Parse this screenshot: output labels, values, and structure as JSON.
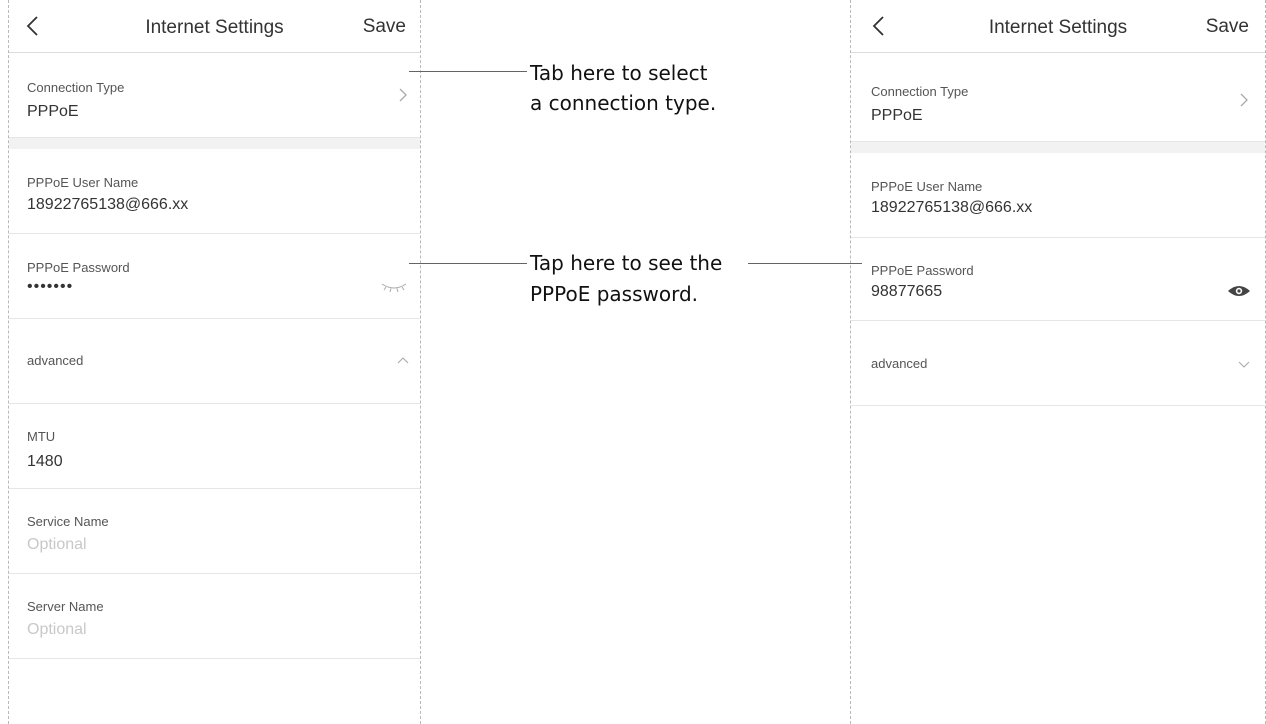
{
  "left_screen": {
    "header": {
      "back_icon": "chevron-left-icon",
      "title": "Internet Settings",
      "save_label": "Save"
    },
    "connection_type": {
      "label": "Connection Type",
      "value": "PPPoE",
      "icon": "chevron-right-icon"
    },
    "user_name": {
      "label": "PPPoE User Name",
      "value": "18922765138@666.xx"
    },
    "password": {
      "label": "PPPoE Password",
      "value": "•••••••",
      "icon": "eye-closed-icon"
    },
    "advanced": {
      "label": "advanced",
      "icon": "chevron-up-icon"
    },
    "mtu": {
      "label": "MTU",
      "value": "1480"
    },
    "service_name": {
      "label": "Service Name",
      "placeholder": "Optional"
    },
    "server_name": {
      "label": "Server Name",
      "placeholder": "Optional"
    }
  },
  "right_screen": {
    "header": {
      "back_icon": "chevron-left-icon",
      "title": "Internet Settings",
      "save_label": "Save"
    },
    "connection_type": {
      "label": "Connection Type",
      "value": "PPPoE",
      "icon": "chevron-right-icon"
    },
    "user_name": {
      "label": "PPPoE User Name",
      "value": "18922765138@666.xx"
    },
    "password": {
      "label": "PPPoE Password",
      "value": "98877665",
      "icon": "eye-open-icon"
    },
    "advanced": {
      "label": "advanced",
      "icon": "chevron-down-icon"
    }
  },
  "callouts": {
    "connection_line1": "Tab here to select",
    "connection_line2": "a connection type.",
    "password_line1": "Tap here to see the",
    "password_line2": "PPPoE password."
  },
  "colors": {
    "callout_line": "#2f6ebd",
    "divider": "#e6e6e6",
    "section_gap": "#f2f2f2",
    "placeholder": "#c8c8c8"
  }
}
